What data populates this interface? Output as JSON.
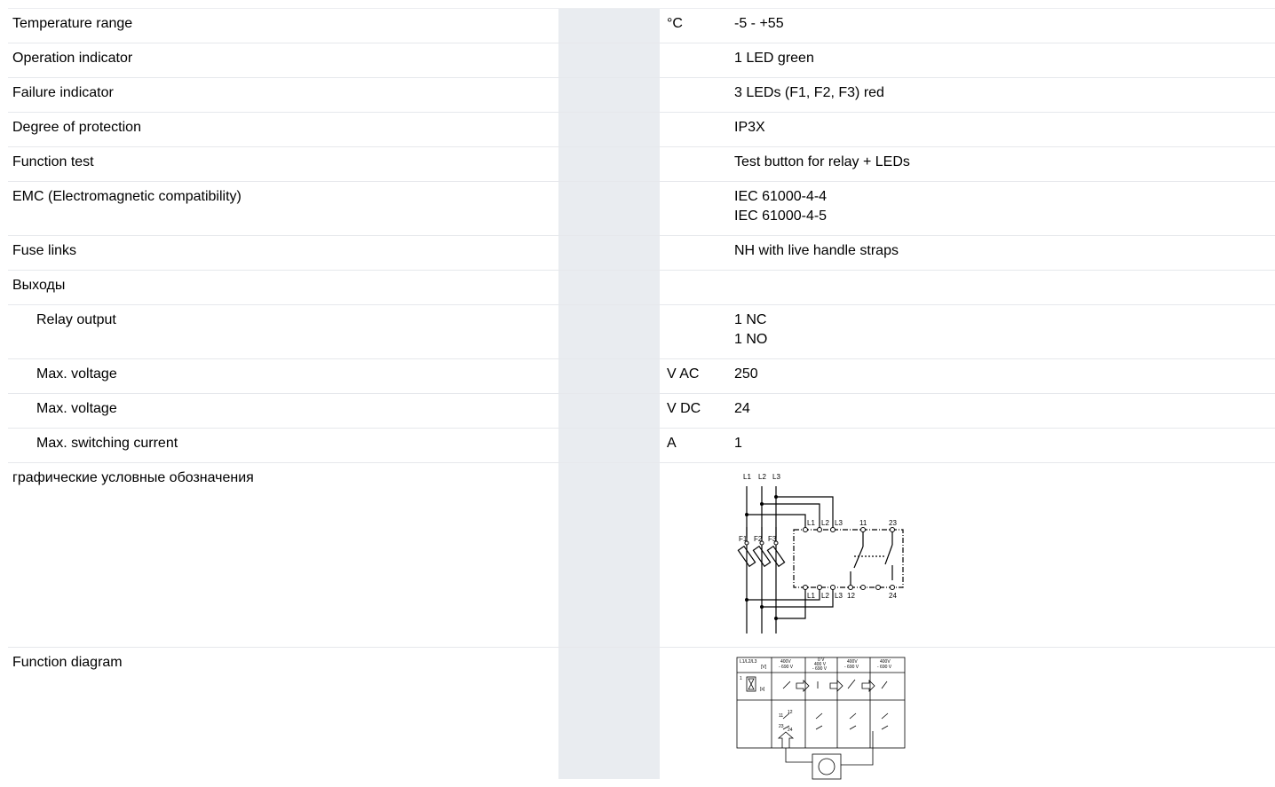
{
  "rows": [
    {
      "name": "Temperature range",
      "unit": "°C",
      "value": [
        "-5 - +55"
      ]
    },
    {
      "name": "Operation indicator",
      "unit": "",
      "value": [
        "1 LED green"
      ]
    },
    {
      "name": "Failure indicator",
      "unit": "",
      "value": [
        "3 LEDs (F1, F2, F3) red"
      ]
    },
    {
      "name": "Degree of protection",
      "unit": "",
      "value": [
        "IP3X"
      ]
    },
    {
      "name": "Function test",
      "unit": "",
      "value": [
        "Test button for relay + LEDs"
      ]
    },
    {
      "name": "EMC (Electromagnetic compatibility)",
      "unit": "",
      "value": [
        "IEC 61000-4-4",
        "IEC 61000-4-5"
      ]
    },
    {
      "name": "Fuse links",
      "unit": "",
      "value": [
        "NH with live handle straps"
      ]
    },
    {
      "name": "Выходы",
      "unit": "",
      "value": []
    },
    {
      "name": "Relay output",
      "unit": "",
      "value": [
        "1 NC",
        "1 NO"
      ]
    },
    {
      "name": "Max. voltage",
      "unit": "V AC",
      "value": [
        "250"
      ]
    },
    {
      "name": "Max. voltage",
      "unit": "V DC",
      "value": [
        "24"
      ]
    },
    {
      "name": "Max. switching current",
      "unit": "A",
      "value": [
        "1"
      ]
    },
    {
      "name": "графические условные обозначения",
      "unit": "",
      "value": []
    },
    {
      "name": "Function diagram",
      "unit": "",
      "value": []
    }
  ],
  "circuit_symbol": {
    "top_labels": [
      "L1",
      "L2",
      "L3"
    ],
    "fuse_labels": [
      "F1",
      "F2",
      "F3"
    ],
    "device_top_labels": [
      "L1",
      "L2",
      "L3",
      "11",
      "23"
    ],
    "device_bottom_labels": [
      "L1",
      "L2",
      "L3",
      "12",
      "24"
    ]
  },
  "function_diagram": {
    "header": [
      "L1/L2/L3",
      "[V]",
      "400V",
      "- 690 V",
      "0 V",
      "400 V",
      "- 690 V",
      "400V",
      "- 690 V",
      "400V",
      "- 690 V"
    ],
    "time_unit": "[s]",
    "time_value": "1",
    "contacts": [
      "11",
      "12",
      "23",
      "24"
    ]
  }
}
